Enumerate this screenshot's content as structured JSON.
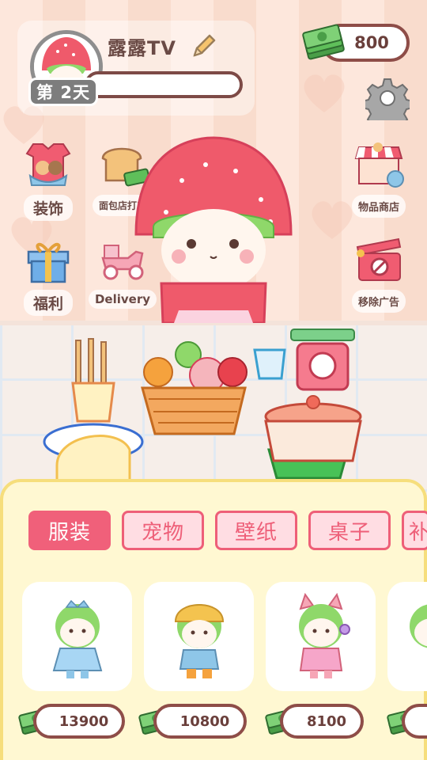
{
  "player": {
    "name": "露露TV",
    "day_label": "第 2天",
    "xp_progress": 0.0
  },
  "currency": {
    "cash": "800"
  },
  "side_menu": {
    "decorate": "装饰",
    "bakery_job": "面包店打工",
    "welfare": "福利",
    "delivery": "Delivery",
    "shop": "物品商店",
    "remove_ads": "移除广告"
  },
  "tabs": [
    {
      "label": "服装",
      "active": true
    },
    {
      "label": "宠物",
      "active": false
    },
    {
      "label": "壁纸",
      "active": false
    },
    {
      "label": "桌子",
      "active": false
    },
    {
      "label": "补",
      "active": false
    }
  ],
  "items": [
    {
      "name": "blue-crown-dress",
      "price": "13900"
    },
    {
      "name": "yellow-beanie-outfit",
      "price": "10800"
    },
    {
      "name": "cat-ear-headphone-outfit",
      "price": "8100"
    },
    {
      "name": "partial-item",
      "price": ""
    }
  ],
  "colors": {
    "accent": "#f0607a",
    "panel": "#fff8d2",
    "border": "#8e4d48",
    "cash_green": "#5fbf5a"
  }
}
